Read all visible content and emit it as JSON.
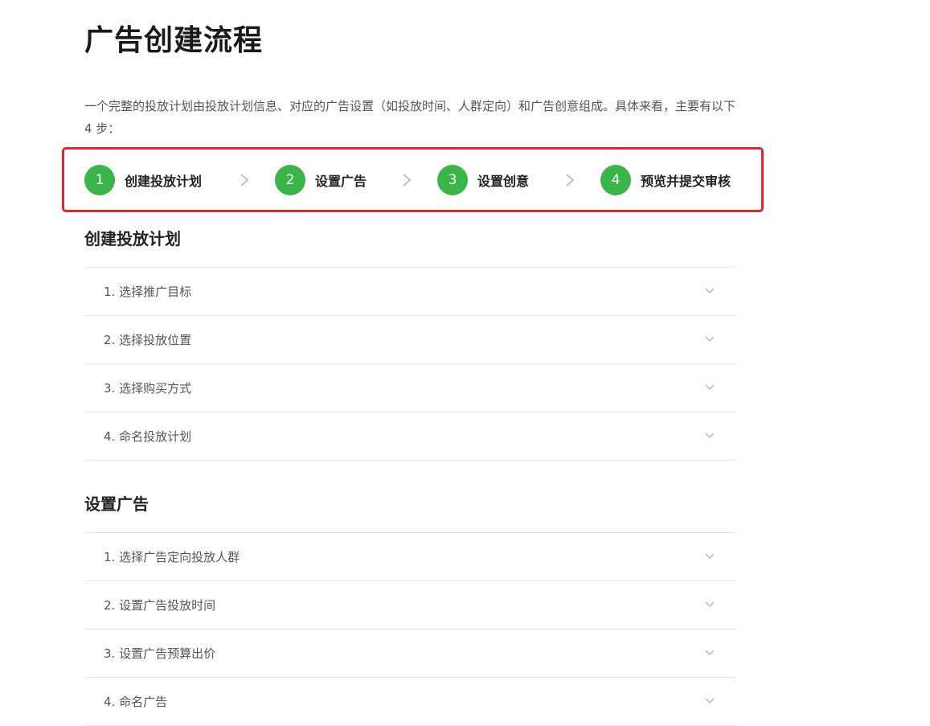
{
  "title": "广告创建流程",
  "intro": "一个完整的投放计划由投放计划信息、对应的广告设置（如投放时间、人群定向）和广告创意组成。具体来看，主要有以下 4 步：",
  "colors": {
    "step_green": "#3ab54a",
    "highlight_border": "#e0262b"
  },
  "steps": [
    {
      "num": "1",
      "label": "创建投放计划"
    },
    {
      "num": "2",
      "label": "设置广告"
    },
    {
      "num": "3",
      "label": "设置创意"
    },
    {
      "num": "4",
      "label": "预览并提交审核"
    }
  ],
  "icons": {
    "step_separator": "chevron-right-icon",
    "accordion_toggle": "chevron-down-icon"
  },
  "sections": [
    {
      "title": "创建投放计划",
      "items": [
        "1. 选择推广目标",
        "2. 选择投放位置",
        "3. 选择购买方式",
        "4. 命名投放计划"
      ]
    },
    {
      "title": "设置广告",
      "items": [
        "1. 选择广告定向投放人群",
        "2. 设置广告投放时间",
        "3. 设置广告预算出价",
        "4. 命名广告"
      ]
    }
  ]
}
